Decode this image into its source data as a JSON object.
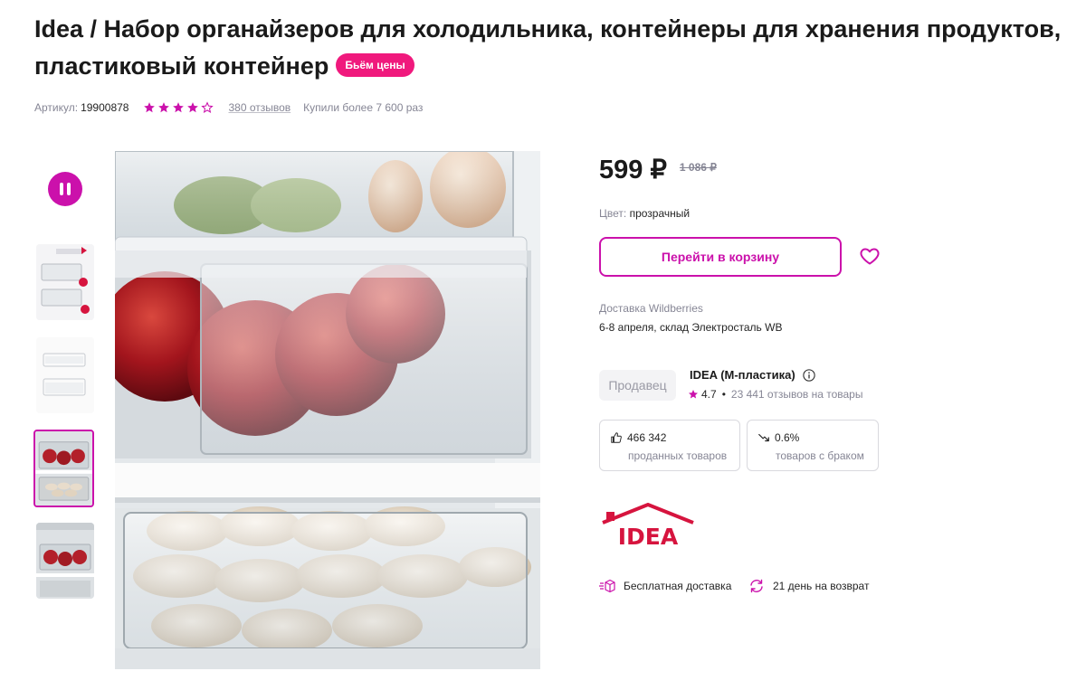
{
  "product": {
    "title": "Idea / Набор органайзеров для холодильника, контейнеры для хранения продуктов, пластиковый контейнер",
    "promo_badge": "Бьём цены",
    "article_label": "Артикул:",
    "article_value": "19900878",
    "rating_stars": 4,
    "reviews_link": "380 отзывов",
    "bought_text": "Купили более 7 600 раз"
  },
  "gallery": {
    "pause_icon": "pause-icon",
    "thumbnails": [
      "thumb-1",
      "thumb-2",
      "thumb-3",
      "thumb-4"
    ],
    "active_thumbnail": 3
  },
  "price": {
    "current": "599 ₽",
    "old": "1 086 ₽"
  },
  "color": {
    "label": "Цвет:",
    "value": "прозрачный"
  },
  "cart_button": "Перейти в корзину",
  "delivery": {
    "label": "Доставка Wildberries",
    "value": "6-8 апреля, склад Электросталь WB"
  },
  "seller": {
    "tag": "Продавец",
    "name": "IDEA (М-пластика)",
    "rating": "4.7",
    "reviews": "23 441 отзывов на товары"
  },
  "stats": {
    "sold_value": "466 342",
    "sold_label": "проданных товаров",
    "defect_value": "0.6%",
    "defect_label": "товаров с браком"
  },
  "brand_logo_text": "IDEA",
  "features": {
    "free_delivery": "Бесплатная доставка",
    "return": "21 день на возврат"
  },
  "colors": {
    "accent": "#cb11ab",
    "badge": "#f0197d",
    "star": "#cb11ab",
    "logo": "#d6143e"
  }
}
